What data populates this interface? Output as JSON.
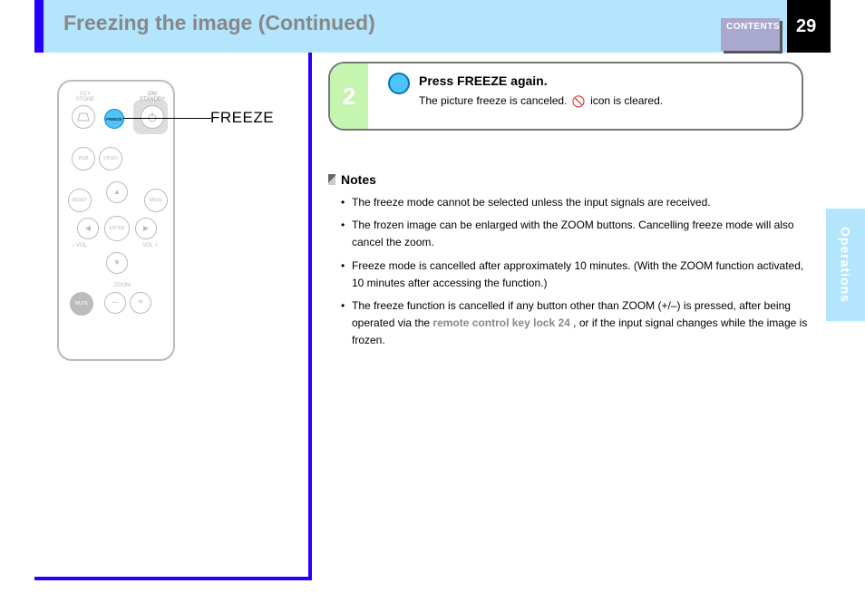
{
  "header": {
    "title": "Freezing the image (Continued)",
    "contents_label": "CONTENTS",
    "page_number": "29"
  },
  "side_tab": "Operations",
  "remote": {
    "labels": {
      "keystone": "KEY\nSTONE",
      "on_standby": "ON/\nSTANDBY",
      "rgb": "RGB",
      "video": "VIDEO",
      "reset": "RESET",
      "menu": "MENU",
      "enter": "ENTER",
      "vol_minus": "VOL",
      "vol_plus": "VOL",
      "mute": "MUTE",
      "zoom": "ZOOM"
    },
    "freeze_text": "FREEZE",
    "pointer_label": "FREEZE"
  },
  "step": {
    "number": "2",
    "title": "Press FREEZE again.",
    "body_prefix": "The picture freeze is canceled.",
    "body_icon_semantic": "prohibited-icon",
    "body_suffix": " icon is cleared."
  },
  "notes": {
    "heading": "Notes",
    "items": [
      "The freeze mode cannot be selected unless the input signals are received.",
      "The frozen image can be enlarged with the ZOOM buttons. Cancelling freeze mode will also cancel the zoom.",
      "Freeze mode is cancelled after approximately 10 minutes. (With the ZOOM function activated, 10 minutes after accessing the function.)",
      {
        "prefix": "The freeze function is cancelled if any button other than ZOOM (+/–) is pressed, after being operated via the ",
        "link": "remote control key lock",
        "page_ref": "24",
        "suffix": ", or if the input signal changes while the image is frozen."
      }
    ]
  }
}
